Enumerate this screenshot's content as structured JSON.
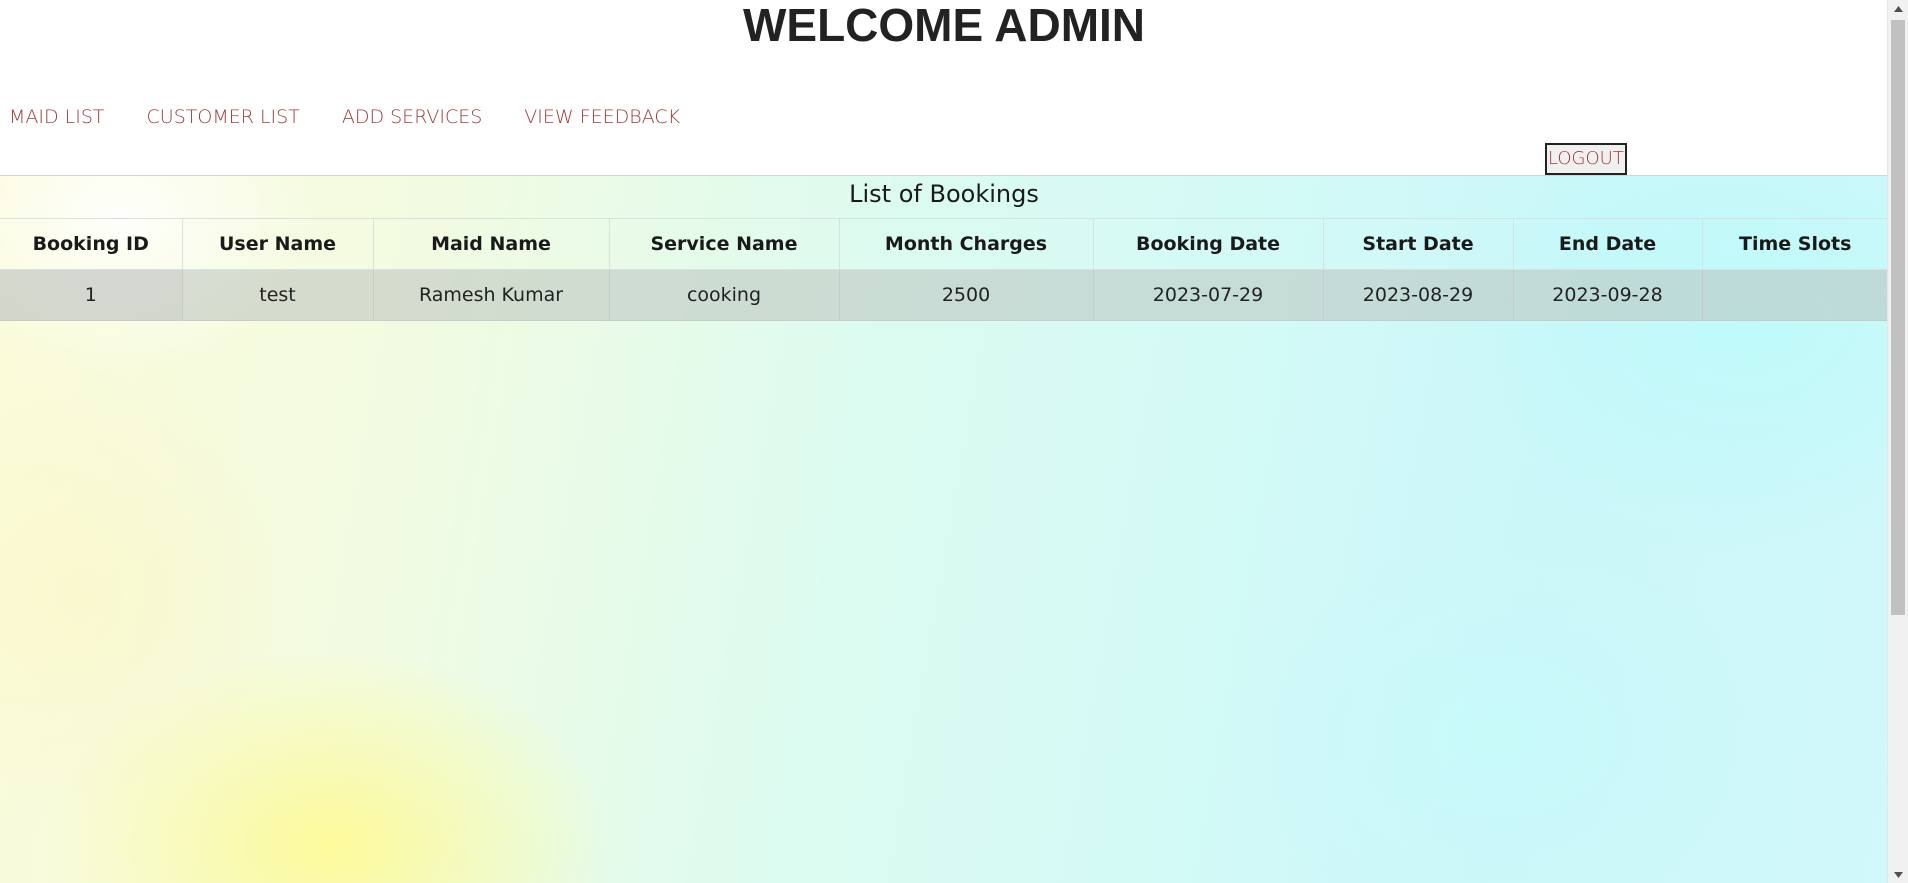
{
  "header": {
    "title": "WELCOME ADMIN",
    "nav": [
      {
        "label": "MAID LIST"
      },
      {
        "label": "CUSTOMER LIST"
      },
      {
        "label": "ADD SERVICES"
      },
      {
        "label": "VIEW FEEDBACK"
      }
    ],
    "logout_label": "LOGOUT"
  },
  "bookings": {
    "title": "List of Bookings",
    "columns": [
      "Booking ID",
      "User Name",
      "Maid Name",
      "Service Name",
      "Month Charges",
      "Booking Date",
      "Start Date",
      "End Date",
      "Time Slots"
    ],
    "rows": [
      {
        "booking_id": "1",
        "user_name": "test",
        "maid_name": "Ramesh Kumar",
        "service_name": "cooking",
        "month_charges": "2500",
        "booking_date": "2023-07-29",
        "start_date": "2023-08-29",
        "end_date": "2023-09-28",
        "time_slots": ""
      }
    ]
  },
  "scrollbar": {
    "up_icon": "scroll-up-arrow",
    "down_icon": "scroll-down-arrow"
  },
  "colors": {
    "nav_link": "#9b3a3a",
    "title": "#222222",
    "row_bg": "#b9c3be"
  }
}
